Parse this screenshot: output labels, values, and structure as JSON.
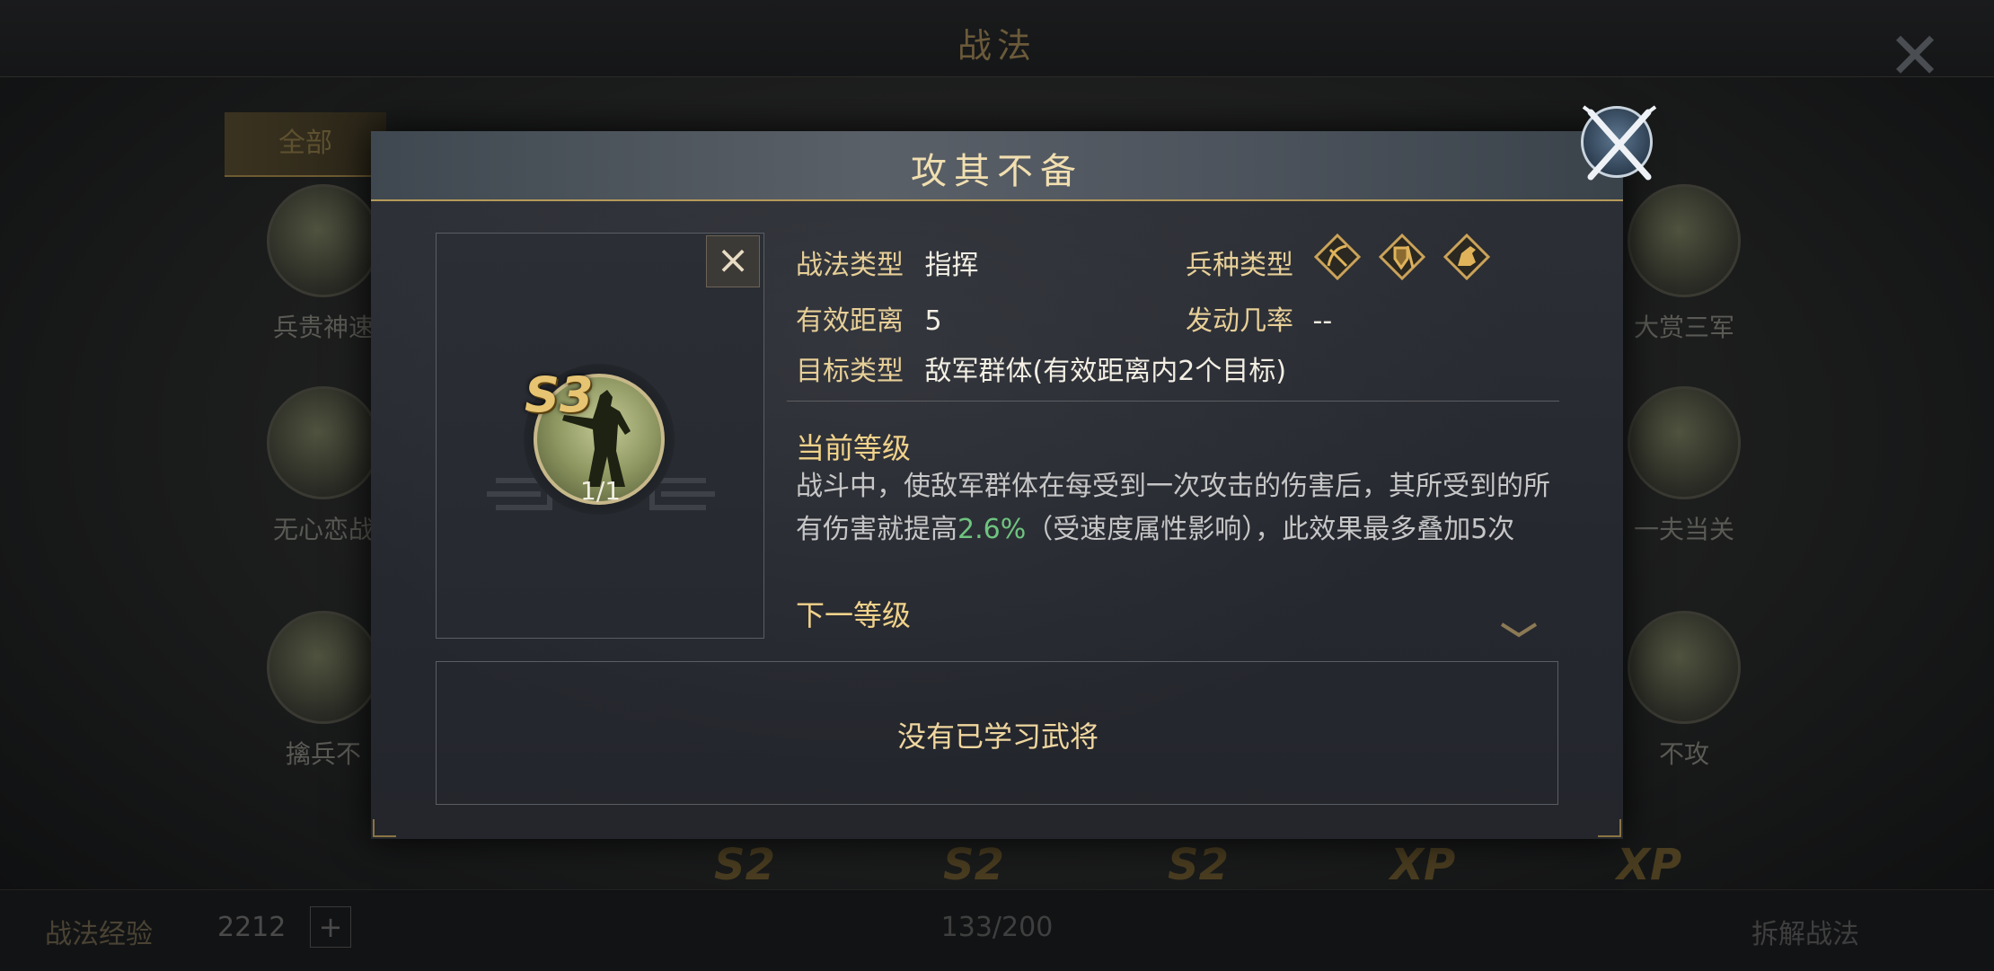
{
  "background": {
    "title": "战法",
    "tab_active": "全部",
    "skills": [
      {
        "name": "兵贵神速"
      },
      {
        "name": "大赏三军"
      },
      {
        "name": "无心恋战"
      },
      {
        "name": "一夫当关"
      },
      {
        "name": "擒兵不"
      },
      {
        "name": "不攻"
      }
    ],
    "row5_grades": [
      "S2",
      "S2",
      "S2",
      "XP",
      "XP"
    ],
    "bottom": {
      "exp_label": "战法经验",
      "exp_value": "2212",
      "plus": "+",
      "page": "133/200",
      "dismantle": "拆解战法"
    }
  },
  "dialog": {
    "title": "攻其不备",
    "skill": {
      "grade": "S3",
      "level": "1/1"
    },
    "info": {
      "type_label": "战法类型",
      "type_value": "指挥",
      "troop_label": "兵种类型",
      "troop_icons": [
        "bow-cavalry-icon",
        "shield-infantry-icon",
        "horse-cavalry-icon"
      ],
      "range_label": "有效距离",
      "range_value": "5",
      "rate_label": "发动几率",
      "rate_value": "--",
      "target_label": "目标类型",
      "target_value": "敌军群体(有效距离内2个目标)"
    },
    "current_level_title": "当前等级",
    "description": {
      "part1": "战斗中，使敌军群体在每受到一次攻击的伤害后，其所受到的所有伤害就提高",
      "highlight": "2.6%",
      "part2": "（受速度属性影响），此效果最多叠加5次"
    },
    "next_level_title": "下一等级",
    "no_generals_text": "没有已学习武将"
  },
  "colors": {
    "gold_label": "#e7cf97",
    "highlight_green": "#6ec47f",
    "title_gold": "#f1dfb0"
  }
}
